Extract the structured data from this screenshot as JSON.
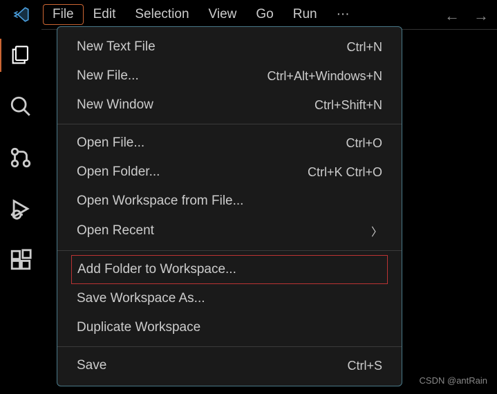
{
  "menubar": {
    "items": [
      "File",
      "Edit",
      "Selection",
      "View",
      "Go",
      "Run"
    ],
    "ellipsis": "···"
  },
  "dropdown": {
    "groups": [
      [
        {
          "label": "New Text File",
          "shortcut": "Ctrl+N"
        },
        {
          "label": "New File...",
          "shortcut": "Ctrl+Alt+Windows+N"
        },
        {
          "label": "New Window",
          "shortcut": "Ctrl+Shift+N"
        }
      ],
      [
        {
          "label": "Open File...",
          "shortcut": "Ctrl+O"
        },
        {
          "label": "Open Folder...",
          "shortcut": "Ctrl+K Ctrl+O"
        },
        {
          "label": "Open Workspace from File...",
          "shortcut": ""
        },
        {
          "label": "Open Recent",
          "shortcut": "",
          "submenu": true
        }
      ],
      [
        {
          "label": "Add Folder to Workspace...",
          "shortcut": "",
          "highlighted": true
        },
        {
          "label": "Save Workspace As...",
          "shortcut": ""
        },
        {
          "label": "Duplicate Workspace",
          "shortcut": ""
        }
      ],
      [
        {
          "label": "Save",
          "shortcut": "Ctrl+S"
        }
      ]
    ]
  },
  "watermark": "CSDN @antRain"
}
